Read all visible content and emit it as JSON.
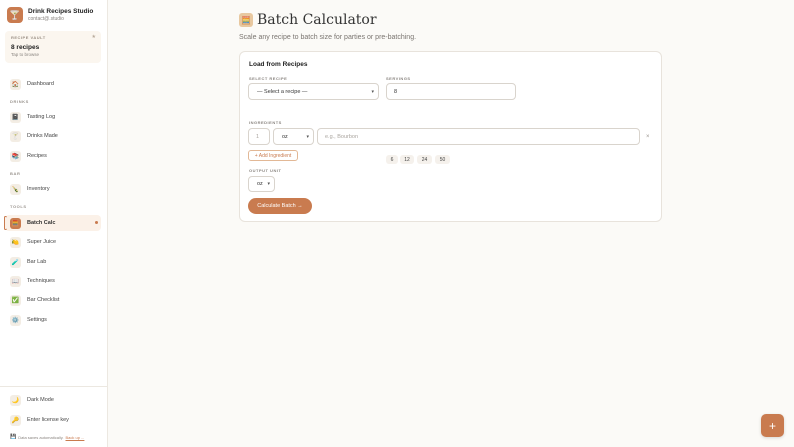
{
  "app": {
    "name": "Drink Recipes Studio",
    "account": "contact@.studio",
    "logo_icon": "cocktail-glass-icon"
  },
  "vault": {
    "label": "RECIPE VAULT",
    "count": "8 recipes",
    "hint": "Tap to browse",
    "star": "★"
  },
  "sidebar": {
    "dashboard": {
      "label": "Dashboard",
      "icon": "🏠"
    },
    "drinks_section": "DRINKS",
    "tasting_log": {
      "label": "Tasting Log",
      "icon": "📓"
    },
    "drinks_made": {
      "label": "Drinks Made",
      "icon": "🍸"
    },
    "recipes": {
      "label": "Recipes",
      "icon": "📚"
    },
    "bar_section": "BAR",
    "inventory": {
      "label": "Inventory",
      "icon": "🍾"
    },
    "tools_section": "TOOLS",
    "batch_calc": {
      "label": "Batch Calc",
      "icon": "🧮"
    },
    "super_juice": {
      "label": "Super Juice",
      "icon": "🍋"
    },
    "bar_lab": {
      "label": "Bar Lab",
      "icon": "🧪"
    },
    "techniques": {
      "label": "Techniques",
      "icon": "📖"
    },
    "bar_checklist": {
      "label": "Bar Checklist",
      "icon": "✅"
    },
    "settings": {
      "label": "Settings",
      "icon": "⚙️"
    },
    "dark_mode": {
      "label": "Dark Mode",
      "icon": "🌙"
    },
    "license": {
      "label": "Enter license key",
      "icon": "🔑"
    },
    "autosave": {
      "text": "Data saves automatically.",
      "link": "Back up ...",
      "icon": "💾"
    }
  },
  "main": {
    "title": "Batch Calculator",
    "title_icon": "🧮",
    "subtitle": "Scale any recipe to batch size for parties or pre-batching.",
    "card_title": "Load from Recipes",
    "select_recipe_label": "SELECT RECIPE",
    "select_recipe_value": "— Select a recipe —",
    "servings_label": "SERVINGS",
    "servings_value": "8",
    "quick_servings": [
      "6",
      "12",
      "24",
      "50"
    ],
    "ingredients_label": "INGREDIENTS",
    "amount_placeholder": "1",
    "unit_value": "oz",
    "ingredient_placeholder": "e.g., Bourbon",
    "remove_symbol": "×",
    "add_ingredient": "+ Add Ingredient",
    "output_unit_label": "OUTPUT UNIT",
    "output_unit_value": "oz",
    "calculate_button": "Calculate Batch →"
  },
  "fab": {
    "symbol": "+"
  },
  "colors": {
    "accent": "#c97b4f",
    "background": "#fbfaf7"
  }
}
